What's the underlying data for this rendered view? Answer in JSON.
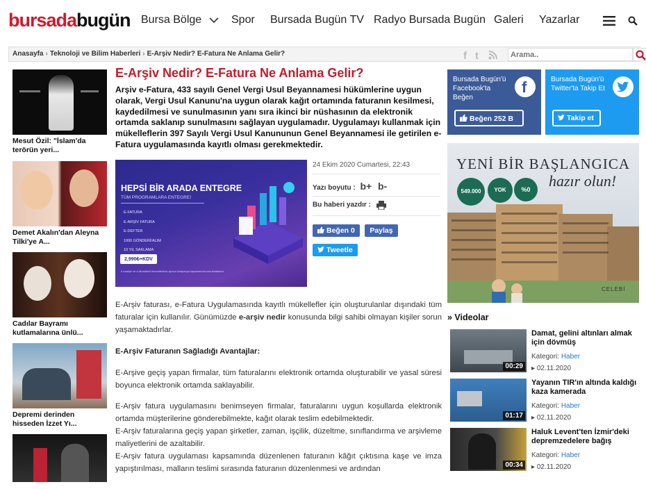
{
  "site": {
    "logo_part1": "bursada",
    "logo_part2": "bugün"
  },
  "nav": {
    "items": [
      "Bursa Bölge",
      "Spor",
      "Bursada Bugün TV",
      "Radyo Bursada Bugün",
      "Galeri",
      "Yazarlar"
    ]
  },
  "breadcrumb": [
    "Anasayfa",
    "Teknoloji ve Bilim Haberleri",
    "E-Arşiv Nedir? E-Fatura Ne Anlama Gelir?"
  ],
  "search": {
    "placeholder": "Arama.."
  },
  "sidebar": {
    "items": [
      {
        "caption": "Mesut Özil: \"İslam'da terörün yeri..."
      },
      {
        "caption": "Demet Akalın'dan Aleyna Tilki'ye A..."
      },
      {
        "caption": "Cadılar Bayramı kutlamalarına ünlü..."
      },
      {
        "caption": "Depremi derinden hisseden İzzet Yı..."
      },
      {
        "caption": ""
      }
    ]
  },
  "article": {
    "title": "E-Arşiv Nedir? E-Fatura Ne Anlama Gelir?",
    "lead": "Arşiv e-Fatura, 433 sayılı Genel Vergi Usul Beyannamesi hükümlerine uygun olarak, Vergi Usul Kanunu'na uygun olarak kağıt ortamında faturanın kesilmesi, kaydedilmesi ve sunulmasının yanı sıra ikinci bir nüshasının da elektronik ortamda saklanıp sunulmasını sağlayan uygulamadır. Uygulamayı kullanmak için mükelleflerin 397 Sayılı Vergi Usul Kanununun Genel Beyannamesi ile getirilen e-Fatura uygulamasında kayıtlı olması gerekmektedir.",
    "date": "24 Ekim 2020 Cumartesi, 22:43",
    "font_size_label": "Yazı boyutu :",
    "font_plus": "b+",
    "font_minus": "b-",
    "print_label": "Bu haberi yazdır :",
    "like_label": "Beğen 0",
    "share_label": "Paylaş",
    "tweet_label": "Tweetle",
    "hero": {
      "headline1": "HEPSİ BİR ARADA",
      "headline2": "ENTEGRE",
      "tagline": "TÜM PROGRAMLARA ENTEGRE!",
      "features": [
        "E-FATURA",
        "E-ARŞİV FATURA",
        "E-DEFTER",
        "1000 GÖNDERİ/ALIM",
        "10 YIL SAKLAMA"
      ],
      "price": "2,990₺+KDV",
      "footnote": "e-irsaliye ve e-Müstahsil hizmetlerimiz ayrıca kampanya kapsamında sunulmaktadır."
    },
    "p1_a": "E-Arşiv faturası, e-Fatura Uygulamasında kayıtlı mükellefler için oluşturulanlar dışındaki tüm faturalar için kullanılır. Günümüzde ",
    "p1_bold": "e-arşiv nedir",
    "p1_b": " konusunda bilgi sahibi olmayan kişiler sorun yaşamaktadırlar.",
    "subheading": "E-Arşiv Faturanın Sağladığı Avantajlar:",
    "p2": "E-Arşive geçiş yapan firmalar, tüm faturalarını elektronik ortamda oluşturabilir ve yasal süresi boyunca elektronik ortamda saklayabilir.",
    "p3": "E-Arşiv fatura uygulamasını benimseyen firmalar, faturalarını uygun koşullarda elektronik ortamda müşterilerine gönderebilmekte, kağıt olarak teslim edebilmektedir.",
    "p4": "E-Arşiv faturalarına geçiş yapan şirketler, zaman, işçilik, düzeltme, sınıflandırma ve arşivleme maliyetlerini de azaltabilir.",
    "p5": "E-Arşiv fatura uygulaması kapsamında düzenlenen faturanın kâğıt çıktısına kaşe ve imza yapıştırılması, malların teslimi sırasında faturanın düzenlenmesi ve ardından"
  },
  "social": {
    "facebook_text": "Bursada Bugün'ü Facebook'ta Beğen",
    "facebook_btn": "Beğen 252 B",
    "twitter_text": "Bursada Bugün'ü Twitter'ta Takip Et",
    "twitter_btn": "Takip et"
  },
  "ad": {
    "title": "YENİ BİR BAŞLANGICA",
    "subtitle": "hazır olun!",
    "badges": [
      "549.000",
      "YOK",
      "%0"
    ],
    "brand": "CELEBİ"
  },
  "videos": {
    "heading": "» Videolar",
    "category_label": "Kategori:",
    "items": [
      {
        "title": "Damat, gelini altınları almak için dövmüş",
        "duration": "00:29",
        "category": "Haber",
        "date": "02.11.2020"
      },
      {
        "title": "Yayanın TIR'ın altında kaldığı kaza kamerada",
        "duration": "01:17",
        "category": "Haber",
        "date": "02.11.2020"
      },
      {
        "title": "Haluk Levent'ten İzmir'deki depremzedelere bağış",
        "duration": "00:34",
        "category": "Haber",
        "date": "02.11.2020"
      }
    ]
  },
  "colors": {
    "brand_red": "#d3182a",
    "facebook": "#4267b2",
    "twitter": "#1d9bf0",
    "link_blue": "#2f75c4"
  }
}
